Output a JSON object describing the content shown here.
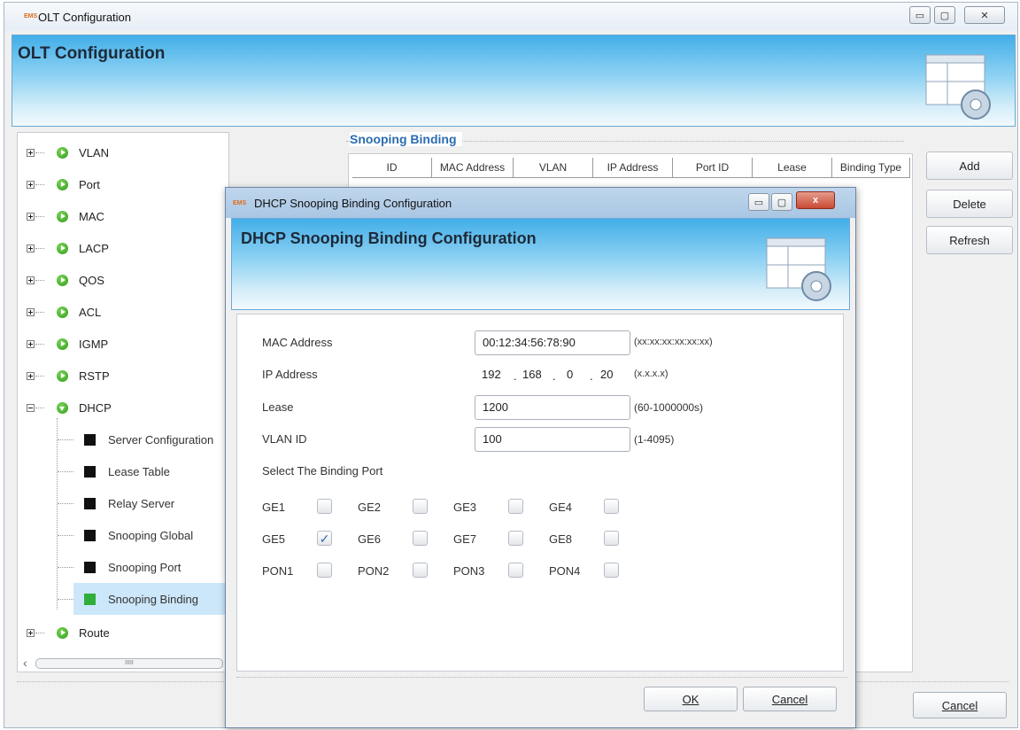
{
  "main_window": {
    "logo_text": "EMS",
    "title": "OLT Configuration",
    "banner_title": "OLT Configuration",
    "controls": {
      "minimize": "▭",
      "maximize": "▢",
      "close": "✕"
    }
  },
  "tree": {
    "items": [
      {
        "label": "VLAN",
        "expanded": false
      },
      {
        "label": "Port",
        "expanded": false
      },
      {
        "label": "MAC",
        "expanded": false
      },
      {
        "label": "LACP",
        "expanded": false
      },
      {
        "label": "QOS",
        "expanded": false
      },
      {
        "label": "ACL",
        "expanded": false
      },
      {
        "label": "IGMP",
        "expanded": false
      },
      {
        "label": "RSTP",
        "expanded": false
      },
      {
        "label": "DHCP",
        "expanded": true
      },
      {
        "label": "Route",
        "expanded": false
      }
    ],
    "dhcp_children": [
      "Server Configuration",
      "Lease Table",
      "Relay Server",
      "Snooping Global",
      "Snooping Port",
      "Snooping Binding"
    ],
    "selected_child": "Snooping Binding",
    "scrollbar_grip": "IIIII"
  },
  "binding_panel": {
    "section_title": "Snooping Binding",
    "columns": [
      "ID",
      "MAC Address",
      "VLAN",
      "IP Address",
      "Port ID",
      "Lease",
      "Binding Type"
    ]
  },
  "side_buttons": {
    "add": "Add",
    "delete": "Delete",
    "refresh": "Refresh"
  },
  "main_cancel": "Cancel",
  "dialog": {
    "logo_text": "EMS",
    "title": "DHCP Snooping Binding Configuration",
    "banner_title": "DHCP Snooping Binding Configuration",
    "controls": {
      "minimize": "▭",
      "maximize": "▢",
      "close": "x"
    },
    "fields": {
      "mac": {
        "label": "MAC Address",
        "value": "00:12:34:56:78:90",
        "hint": "(xx:xx:xx:xx:xx:xx)"
      },
      "ip": {
        "label": "IP Address",
        "octets": [
          "192",
          "168",
          "0",
          "20"
        ],
        "hint": "(x.x.x.x)"
      },
      "lease": {
        "label": "Lease",
        "value": "1200",
        "hint": "(60-1000000s)"
      },
      "vlan": {
        "label": "VLAN ID",
        "value": "100",
        "hint": "(1-4095)"
      }
    },
    "port_section_label": "Select The Binding Port",
    "ports": [
      {
        "name": "GE1",
        "checked": false
      },
      {
        "name": "GE2",
        "checked": false
      },
      {
        "name": "GE3",
        "checked": false
      },
      {
        "name": "GE4",
        "checked": false
      },
      {
        "name": "GE5",
        "checked": true
      },
      {
        "name": "GE6",
        "checked": false
      },
      {
        "name": "GE7",
        "checked": false
      },
      {
        "name": "GE8",
        "checked": false
      },
      {
        "name": "PON1",
        "checked": false
      },
      {
        "name": "PON2",
        "checked": false
      },
      {
        "name": "PON3",
        "checked": false
      },
      {
        "name": "PON4",
        "checked": false
      }
    ],
    "ok": "OK",
    "cancel": "Cancel"
  }
}
